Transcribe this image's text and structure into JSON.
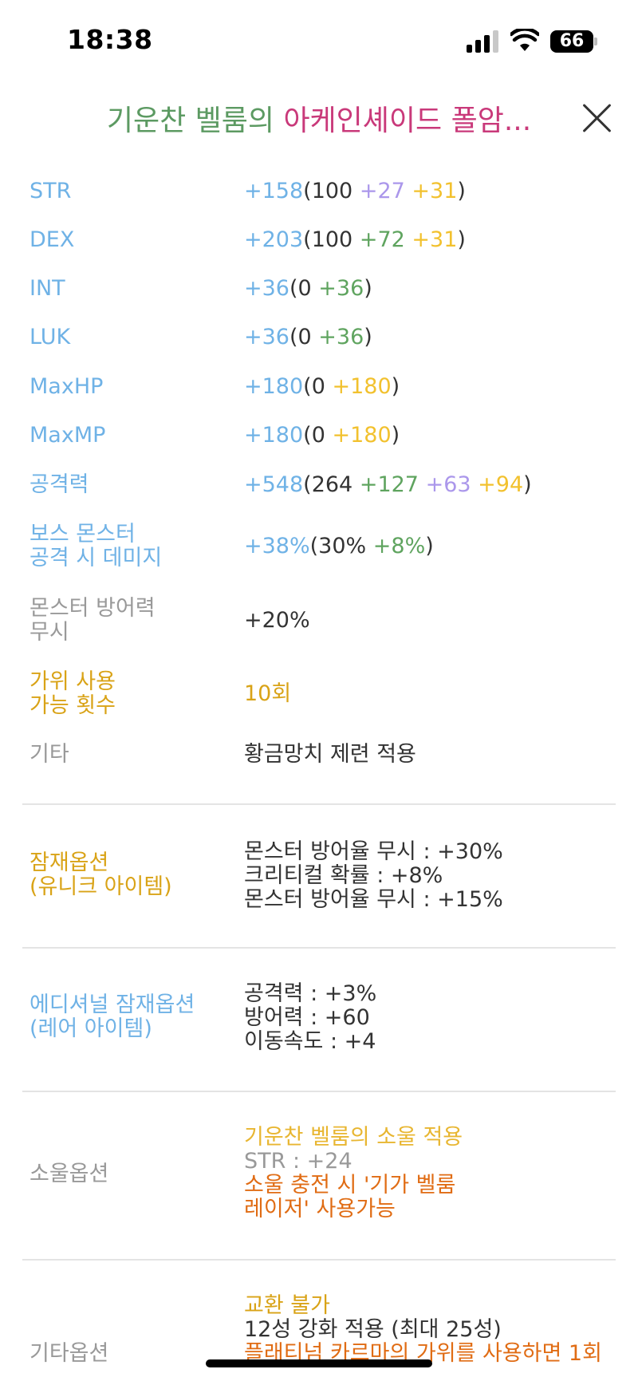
{
  "status_bar": {
    "time": "18:38",
    "battery": "66"
  },
  "header": {
    "title_part1": "기운찬 벨룸의 ",
    "title_part2": "아케인셰이드 폴암..."
  },
  "stats": {
    "str": {
      "label": "STR",
      "total": "+158",
      "base": "(100 ",
      "scroll": "+27 ",
      "bonus": "+31",
      "close": ")"
    },
    "dex": {
      "label": "DEX",
      "total": "+203",
      "base": "(100 ",
      "additional": "+72 ",
      "bonus": "+31",
      "close": ")"
    },
    "int": {
      "label": "INT",
      "total": "+36",
      "base": "(0 ",
      "additional": "+36",
      "close": ")"
    },
    "luk": {
      "label": "LUK",
      "total": "+36",
      "base": "(0 ",
      "additional": "+36",
      "close": ")"
    },
    "maxhp": {
      "label": "MaxHP",
      "total": "+180",
      "base": "(0 ",
      "bonus": "+180",
      "close": ")"
    },
    "maxmp": {
      "label": "MaxMP",
      "total": "+180",
      "base": "(0 ",
      "bonus": "+180",
      "close": ")"
    },
    "attack": {
      "label": "공격력",
      "total": "+548",
      "base": "(264 ",
      "additional": "+127 ",
      "scroll": "+63 ",
      "bonus": "+94",
      "close": ")"
    },
    "boss": {
      "label_line1": "보스 몬스터",
      "label_line2": "공격 시 데미지",
      "total": "+38%",
      "base": "(30% ",
      "additional": "+8%",
      "close": ")"
    },
    "ignore_def": {
      "label_line1": "몬스터 방어력",
      "label_line2": "무시",
      "value": "+20%"
    },
    "scissors": {
      "label_line1": "가위 사용",
      "label_line2": "가능 횟수",
      "value": "10회"
    },
    "etc": {
      "label": "기타",
      "value": "황금망치 제련 적용"
    }
  },
  "potential": {
    "label_line1": "잠재옵션",
    "label_line2": "(유니크 아이템)",
    "lines": [
      "몬스터 방어율 무시 : +30%",
      "크리티컬 확률 : +8%",
      "몬스터 방어율 무시 : +15%"
    ]
  },
  "additional_potential": {
    "label_line1": "에디셔널 잠재옵션",
    "label_line2": "(레어 아이템)",
    "lines": [
      "공격력 : +3%",
      "방어력 : +60",
      "이동속도 : +4"
    ]
  },
  "soul": {
    "label": "소울옵션",
    "name": "기운찬 벨룸의 소울 적용",
    "stat": "STR : +24",
    "skill_line1": "소울 충전 시 '기가 벨룸",
    "skill_line2": "레이저' 사용가능"
  },
  "other": {
    "label": "기타옵션",
    "trade": "교환 불가",
    "starforce": "12성 강화 적용 (최대 25성)",
    "karma_partial": "플래티넘 카르마의 가위를 사용하면 1회"
  },
  "colors": {
    "blue": "#6fb2e6",
    "purple": "#ab97eb",
    "yellow": "#f2c12e",
    "green": "#5fa45f",
    "gold": "#d9a317",
    "gray": "#999999",
    "orange": "#e06c14",
    "title_green": "#5c9a62",
    "title_pink": "#c9397a"
  },
  "icons": {
    "close": "close-icon",
    "signal": "cellular-signal-icon",
    "wifi": "wifi-icon",
    "battery": "battery-icon"
  }
}
